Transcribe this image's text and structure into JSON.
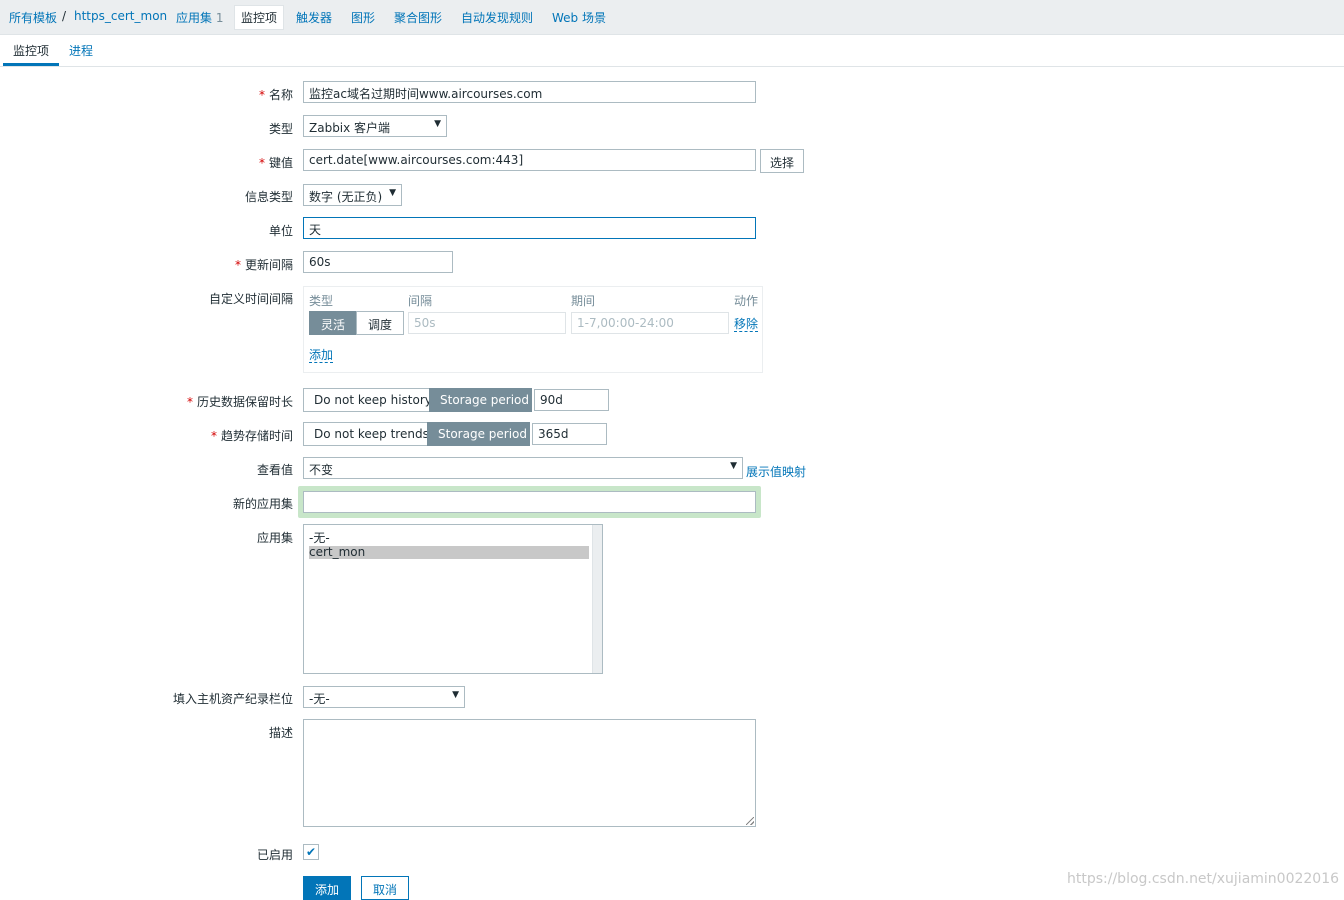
{
  "breadcrumb": {
    "all_templates": "所有模板",
    "separator": "/",
    "template": "https_cert_mon",
    "applications": "应用集",
    "applications_count": "1",
    "items": "监控项",
    "triggers": "触发器",
    "graphs": "图形",
    "screens": "聚合图形",
    "discovery": "自动发现规则",
    "web": "Web 场景"
  },
  "tabs": {
    "item": "监控项",
    "process": "进程"
  },
  "form": {
    "name": {
      "label": "名称",
      "value": "监控ac域名过期时间www.aircourses.com"
    },
    "type": {
      "label": "类型",
      "value": "Zabbix 客户端"
    },
    "key": {
      "label": "键值",
      "value": "cert.date[www.aircourses.com:443]",
      "select_button": "选择"
    },
    "value_type": {
      "label": "信息类型",
      "value": "数字 (无正负)"
    },
    "units": {
      "label": "单位",
      "value": "天"
    },
    "delay": {
      "label": "更新间隔",
      "value": "60s"
    },
    "custom_intervals": {
      "label": "自定义时间间隔",
      "col_type": "类型",
      "col_interval": "间隔",
      "col_period": "期间",
      "col_action": "动作",
      "flexible": "灵活",
      "scheduling": "调度",
      "interval_placeholder": "50s",
      "period_placeholder": "1-7,00:00-24:00",
      "remove": "移除",
      "add": "添加"
    },
    "history": {
      "label": "历史数据保留时长",
      "option_off": "Do not keep history",
      "option_on": "Storage period",
      "value": "90d"
    },
    "trends": {
      "label": "趋势存储时间",
      "option_off": "Do not keep trends",
      "option_on": "Storage period",
      "value": "365d"
    },
    "valuemap": {
      "label": "查看值",
      "value": "不变",
      "link": "展示值映射"
    },
    "new_application": {
      "label": "新的应用集",
      "value": ""
    },
    "applications": {
      "label": "应用集",
      "options": [
        "-无-",
        "cert_mon"
      ],
      "selected": "cert_mon"
    },
    "inventory": {
      "label": "填入主机资产纪录栏位",
      "value": "-无-"
    },
    "description": {
      "label": "描述",
      "value": ""
    },
    "enabled": {
      "label": "已启用",
      "checked": true
    },
    "buttons": {
      "add": "添加",
      "cancel": "取消"
    }
  },
  "watermark": "https://blog.csdn.net/xujiamin0022016",
  "colors": {
    "accent": "#0275b8",
    "segment_active": "#768d99",
    "required": "#d40000"
  }
}
